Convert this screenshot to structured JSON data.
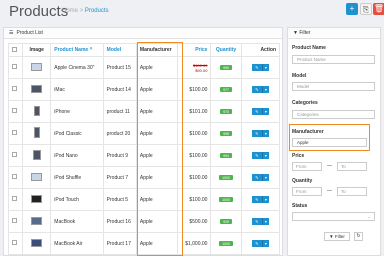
{
  "header": {
    "title": "Products",
    "breadcrumb_home": "Home",
    "breadcrumb_sep": ">",
    "breadcrumb_current": "Products",
    "add_icon": "plus-icon",
    "copy_icon": "copy-icon",
    "delete_icon": "trash-icon"
  },
  "panel": {
    "title": "Product List",
    "icon": "list-icon"
  },
  "columns": {
    "image": "Image",
    "name": "Product Name ^",
    "model": "Model",
    "manufacturer": "Manufacturer",
    "price": "Price",
    "quantity": "Quantity",
    "action": "Action"
  },
  "products": [
    {
      "name": "Apple Cinema 30\"",
      "model": "Product 15",
      "manufacturer": "Apple",
      "price_old": "$100.00",
      "price_new": "$90.00",
      "qty": "990"
    },
    {
      "name": "iMac",
      "model": "Product 14",
      "manufacturer": "Apple",
      "price": "$100.00",
      "qty": "977"
    },
    {
      "name": "iPhone",
      "model": "product 11",
      "manufacturer": "Apple",
      "price": "$101.00",
      "qty": "970"
    },
    {
      "name": "iPod Classic",
      "model": "product 20",
      "manufacturer": "Apple",
      "price": "$100.00",
      "qty": "995"
    },
    {
      "name": "iPod Nano",
      "model": "Product 9",
      "manufacturer": "Apple",
      "price": "$100.00",
      "qty": "994"
    },
    {
      "name": "iPod Shuffle",
      "model": "Product 7",
      "manufacturer": "Apple",
      "price": "$100.00",
      "qty": "1000"
    },
    {
      "name": "iPod Touch",
      "model": "Product 5",
      "manufacturer": "Apple",
      "price": "$100.00",
      "qty": "1000"
    },
    {
      "name": "MacBook",
      "model": "Product 16",
      "manufacturer": "Apple",
      "price": "$500.00",
      "qty": "929"
    },
    {
      "name": "MacBook Air",
      "model": "Product 17",
      "manufacturer": "Apple",
      "price": "$1,000.00",
      "qty": "1000"
    }
  ],
  "filter": {
    "title": "Filter",
    "icon": "filter-icon",
    "product_name_label": "Product Name",
    "product_name_placeholder": "Product Name",
    "model_label": "Model",
    "model_placeholder": "Model",
    "categories_label": "Categories",
    "categories_placeholder": "Categories",
    "manufacturer_label": "Manufacturer",
    "manufacturer_value": "Apple",
    "price_label": "Price",
    "quantity_label": "Quantity",
    "from": "From",
    "to": "To",
    "dash": "—",
    "status_label": "Status",
    "filter_button": "Filter",
    "reset_icon": "eraser-icon"
  },
  "colors": {
    "accent": "#1e91cf",
    "highlight": "#f08a24",
    "qty": "#4cb64c",
    "danger": "#e3503e"
  }
}
